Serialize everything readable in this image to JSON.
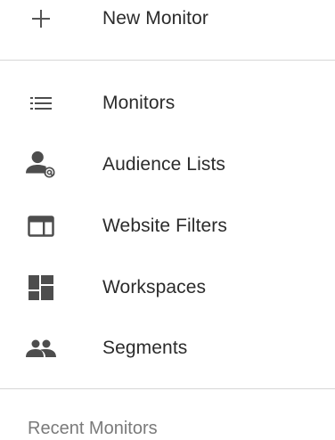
{
  "menu": {
    "new_monitor": {
      "label": "New Monitor",
      "icon": "plus-icon"
    },
    "items": [
      {
        "label": "Monitors",
        "icon": "list-icon"
      },
      {
        "label": "Audience Lists",
        "icon": "person-at-icon"
      },
      {
        "label": "Website Filters",
        "icon": "browser-window-icon"
      },
      {
        "label": "Workspaces",
        "icon": "dashboard-icon"
      },
      {
        "label": "Segments",
        "icon": "group-icon"
      }
    ],
    "recent_title": "Recent Monitors"
  },
  "colors": {
    "icon": "#4d4d4d",
    "text": "#2b2b2b",
    "muted": "#7a7a7a",
    "divider": "#d7d7d7"
  }
}
